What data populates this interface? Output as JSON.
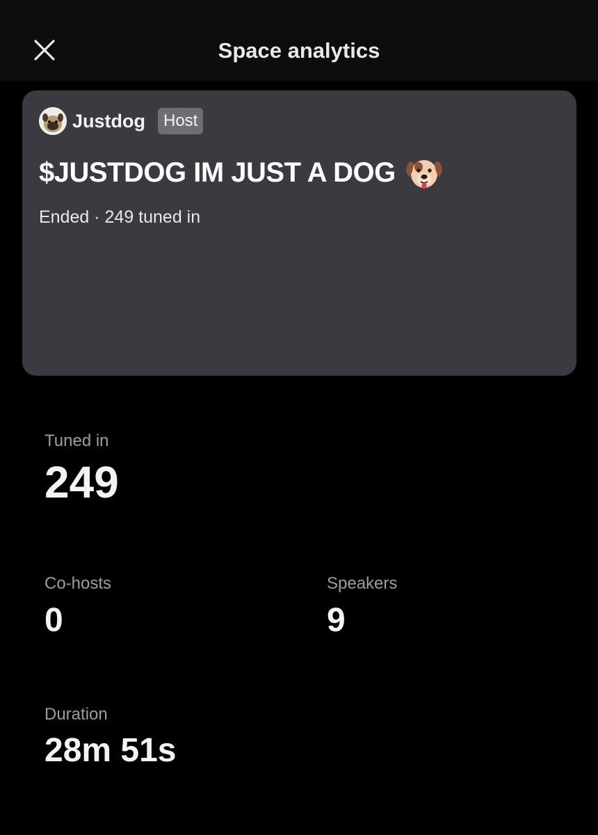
{
  "header": {
    "title": "Space analytics",
    "close_icon": "close-icon"
  },
  "space": {
    "host_name": "Justdog",
    "host_badge": "Host",
    "title": "$JUSTDOG IM JUST A DOG",
    "title_emoji": "dog-face-emoji",
    "meta": "Ended · 249 tuned in"
  },
  "stats": {
    "tuned_in": {
      "label": "Tuned in",
      "value": "249"
    },
    "cohosts": {
      "label": "Co-hosts",
      "value": "0"
    },
    "speakers": {
      "label": "Speakers",
      "value": "9"
    },
    "duration": {
      "label": "Duration",
      "value": "28m 51s"
    }
  },
  "colors": {
    "background": "#000000",
    "card": "#3b3a40",
    "badge": "#6f6e74",
    "muted_text": "#9a9ea3"
  }
}
